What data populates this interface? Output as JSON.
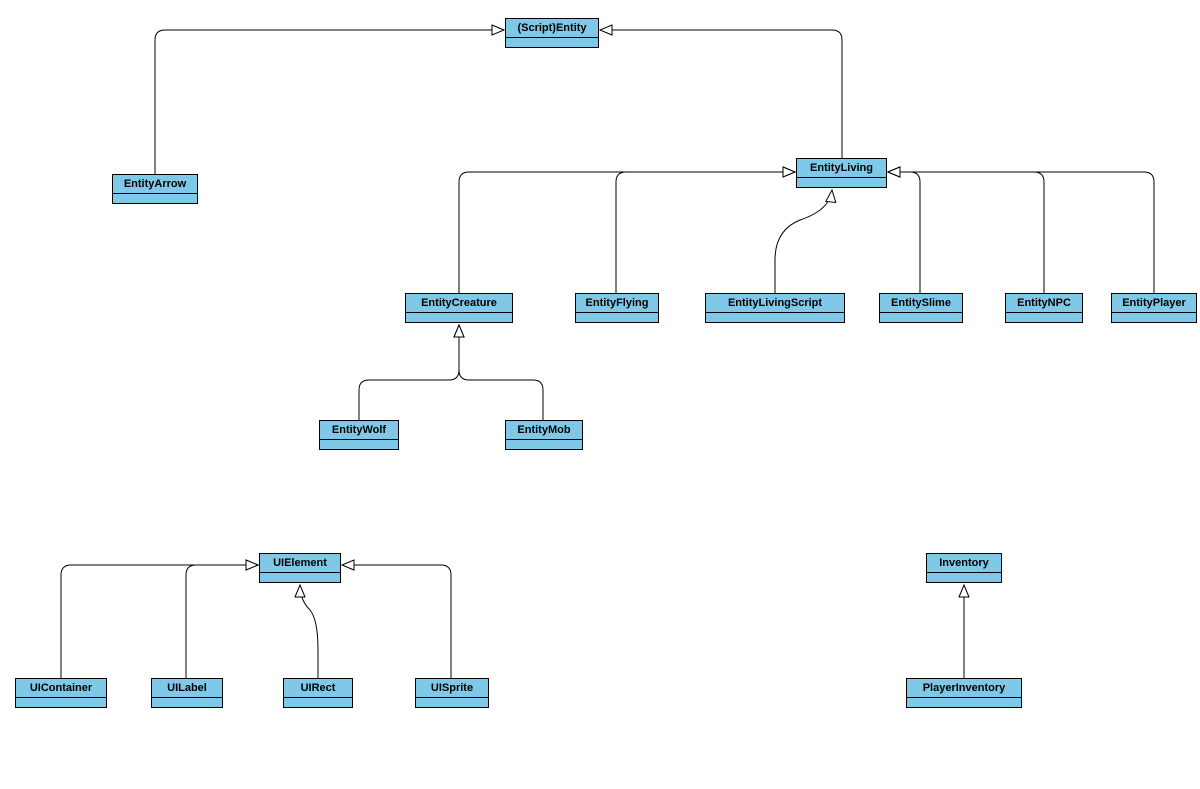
{
  "classes": {
    "scriptEntity": {
      "label": "(Script)Entity"
    },
    "entityArrow": {
      "label": "EntityArrow"
    },
    "entityLiving": {
      "label": "EntityLiving"
    },
    "entityCreature": {
      "label": "EntityCreature"
    },
    "entityFlying": {
      "label": "EntityFlying"
    },
    "entityLivingScript": {
      "label": "EntityLivingScript"
    },
    "entitySlime": {
      "label": "EntitySlime"
    },
    "entityNPC": {
      "label": "EntityNPC"
    },
    "entityPlayer": {
      "label": "EntityPlayer"
    },
    "entityWolf": {
      "label": "EntityWolf"
    },
    "entityMob": {
      "label": "EntityMob"
    },
    "uiElement": {
      "label": "UIElement"
    },
    "uiContainer": {
      "label": "UIContainer"
    },
    "uiLabel": {
      "label": "UILabel"
    },
    "uiRect": {
      "label": "UIRect"
    },
    "uiSprite": {
      "label": "UISprite"
    },
    "inventory": {
      "label": "Inventory"
    },
    "playerInventory": {
      "label": "PlayerInventory"
    }
  },
  "hierarchies": [
    {
      "parent": "scriptEntity",
      "children": [
        "entityArrow",
        "entityLiving"
      ]
    },
    {
      "parent": "entityLiving",
      "children": [
        "entityCreature",
        "entityFlying",
        "entityLivingScript",
        "entitySlime",
        "entityNPC",
        "entityPlayer"
      ]
    },
    {
      "parent": "entityCreature",
      "children": [
        "entityWolf",
        "entityMob"
      ]
    },
    {
      "parent": "uiElement",
      "children": [
        "uiContainer",
        "uiLabel",
        "uiRect",
        "uiSprite"
      ]
    },
    {
      "parent": "inventory",
      "children": [
        "playerInventory"
      ]
    }
  ]
}
